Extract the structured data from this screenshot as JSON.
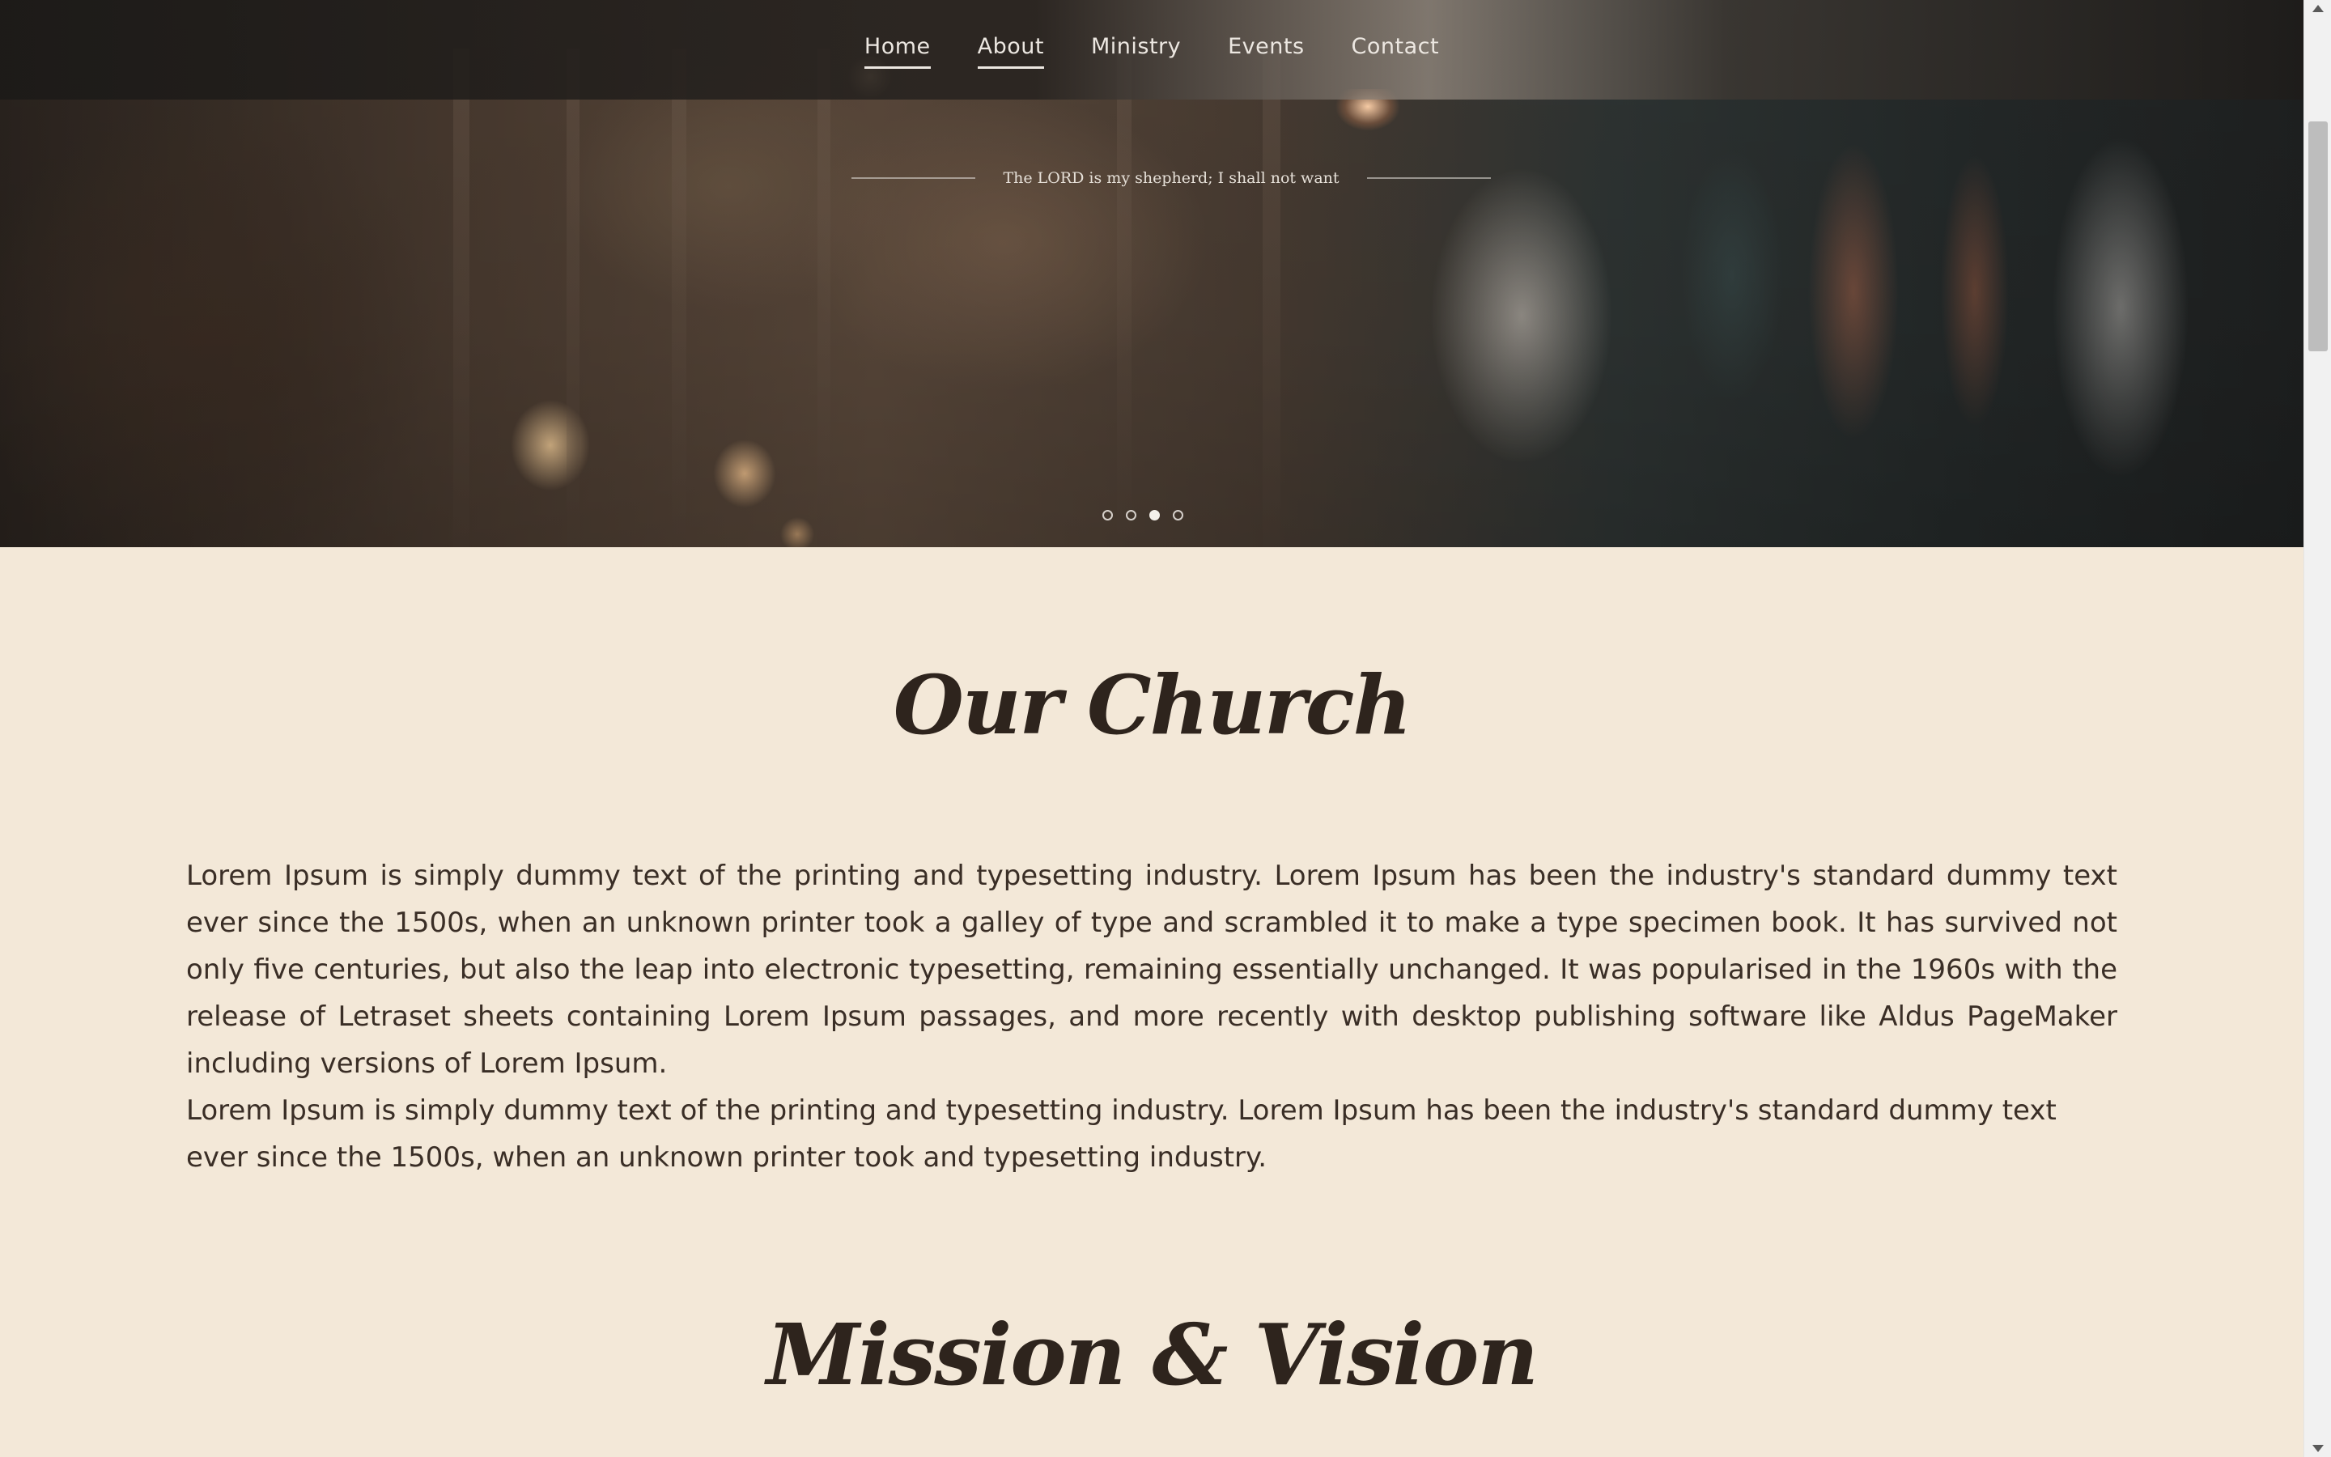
{
  "nav": {
    "items": [
      {
        "label": "Home",
        "active": true
      },
      {
        "label": "About",
        "active": true
      },
      {
        "label": "Ministry",
        "active": false
      },
      {
        "label": "Events",
        "active": false
      },
      {
        "label": "Contact",
        "active": false
      }
    ]
  },
  "hero": {
    "quote": "The LORD is my shepherd; I shall not want",
    "slides": {
      "count": 4,
      "active_index": 2
    }
  },
  "sections": {
    "our_church": {
      "title": "Our Church",
      "paragraphs": [
        "Lorem Ipsum is simply dummy text of the printing and typesetting industry. Lorem Ipsum has been the industry's standard dummy text ever since the 1500s, when an unknown printer took a galley of type and scrambled it to make a type specimen book. It has survived not only five centuries, but also the leap into electronic typesetting, remaining essentially unchanged. It was popularised in the 1960s with the release of Letraset sheets containing Lorem Ipsum passages, and more recently with desktop publishing software like Aldus PageMaker including versions of Lorem Ipsum.",
        "Lorem Ipsum is simply dummy text of the printing and typesetting industry. Lorem Ipsum has been the industry's standard dummy text ever since the 1500s, when an unknown printer took and typesetting industry."
      ]
    },
    "mission": {
      "title": "Mission & Vision"
    }
  },
  "colors": {
    "background": "#f3e8d8",
    "heading": "#2e241d",
    "body_text": "#3a2e26",
    "nav_text": "#ece7e1"
  }
}
